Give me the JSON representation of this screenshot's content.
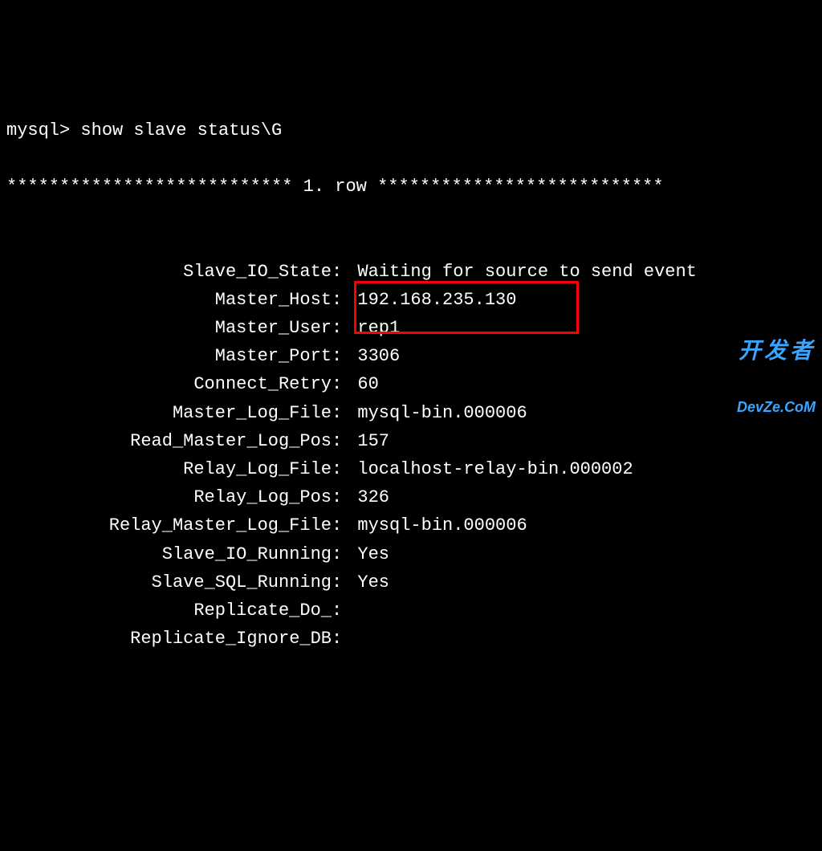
{
  "terminal": {
    "prompt": "mysql> ",
    "command": "show slave status\\G",
    "row_header_left": "*************************** ",
    "row_header_mid": "1. row",
    "row_header_right": " ***************************",
    "fields": [
      {
        "label": "Slave_IO_State",
        "value": "Waiting for source to send event"
      },
      {
        "label": "Master_Host",
        "value": "192.168.235.130",
        "highlight": true
      },
      {
        "label": "Master_User",
        "value": "rep1"
      },
      {
        "label": "Master_Port",
        "value": "3306"
      },
      {
        "label": "Connect_Retry",
        "value": "60"
      },
      {
        "label": "Master_Log_File",
        "value": "mysql-bin.000006"
      },
      {
        "label": "Read_Master_Log_Pos",
        "value": "157"
      },
      {
        "label": "Relay_Log_File",
        "value": "localhost-relay-bin.000002"
      },
      {
        "label": "Relay_Log_Pos",
        "value": "326"
      },
      {
        "label": "Relay_Master_Log_File",
        "value": "mysql-bin.000006"
      },
      {
        "label": "Slave_IO_Running",
        "value": "Yes"
      },
      {
        "label": "Slave_SQL_Running",
        "value": "Yes"
      },
      {
        "label": "Replicate_Do_",
        "value": ""
      },
      {
        "label": "Replicate_Ignore_DB",
        "value": ""
      }
    ]
  },
  "watermark": {
    "line1": "开发者",
    "line2": "DevZe.CoM"
  }
}
